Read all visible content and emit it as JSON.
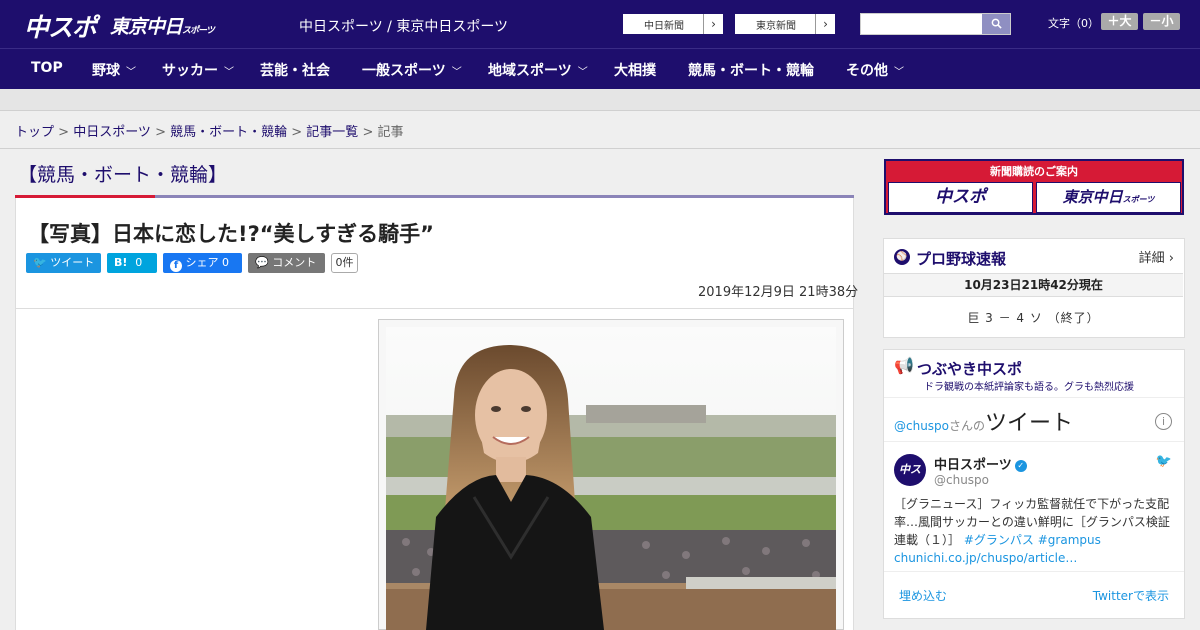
{
  "header": {
    "logo_main": "中スポ",
    "logo_sub": "東京中日",
    "logo_sub_small": "スポーツ",
    "site_links": "中日スポーツ / 東京中日スポーツ",
    "ext_links": [
      {
        "label": "中日新聞",
        "arrow": "›"
      },
      {
        "label": "東京新聞",
        "arrow": "›"
      }
    ],
    "search": {
      "placeholder": "",
      "icon": "search-icon"
    },
    "font_size": {
      "label": "文字（0）",
      "plus": "＋大",
      "minus": "－小"
    }
  },
  "nav": [
    {
      "label": "TOP",
      "has_menu": ""
    },
    {
      "label": "野球",
      "has_menu": "﹀"
    },
    {
      "label": "サッカー",
      "has_menu": "﹀"
    },
    {
      "label": "芸能・社会",
      "has_menu": ""
    },
    {
      "label": "一般スポーツ",
      "has_menu": "﹀"
    },
    {
      "label": "地域スポーツ",
      "has_menu": "﹀"
    },
    {
      "label": "大相撲",
      "has_menu": ""
    },
    {
      "label": "競馬・ボート・競輪",
      "has_menu": ""
    },
    {
      "label": "その他",
      "has_menu": "﹀"
    }
  ],
  "breadcrumb": {
    "items": [
      "トップ",
      "中日スポーツ",
      "競馬・ボート・競輪",
      "記事一覧"
    ],
    "sep": " > ",
    "current": "記事"
  },
  "section": {
    "title": "【競馬・ボート・競輪】"
  },
  "article": {
    "title": "【写真】日本に恋した!?“美しすぎる騎手”",
    "share": {
      "tweet": "ツイート",
      "hatena": "B!",
      "hatena_count": "0",
      "facebook": "シェア",
      "facebook_count": "0",
      "comment": "コメント",
      "comment_count": "0件"
    },
    "date": "2019年12月9日 21時38分"
  },
  "sidebar": {
    "promo": {
      "head": "新聞購読のご案内",
      "left": "中スポ",
      "right": "東京中日",
      "right_small": "スポーツ"
    },
    "baseball": {
      "title": "プロ野球速報",
      "detail": "詳細 ›",
      "time": "10月23日21時42分現在",
      "score": "巨 3 － 4 ソ （終了）"
    },
    "tsubuyaki": {
      "title": "つぶやき中スポ",
      "subtitle": "ドラ観戦の本紙評論家も語る。グラも熱烈応援"
    },
    "twitter": {
      "handle_link": "@chuspo",
      "san_no": "さんの",
      "tweets": "ツイート",
      "info": "i",
      "avatar_text": "中スポ",
      "name": "中日スポーツ",
      "handle": "@chuspo",
      "text": "［グラニュース］フィッカ監督就任で下がった支配率…風間サッカーとの違い鮮明に［グランパス検証連載（１）］",
      "tag1": "#グランパス",
      "tag2": "#grampus",
      "link": "chunichi.co.jp/chuspo/article…",
      "embed": "埋め込む",
      "view": "Twitterで表示"
    }
  },
  "colors": {
    "brand_navy": "#1e0e6d",
    "accent_red": "#d61a36",
    "twitter_blue": "#1b95e0",
    "facebook_blue": "#1877f2",
    "hatena_blue": "#00a4de"
  }
}
